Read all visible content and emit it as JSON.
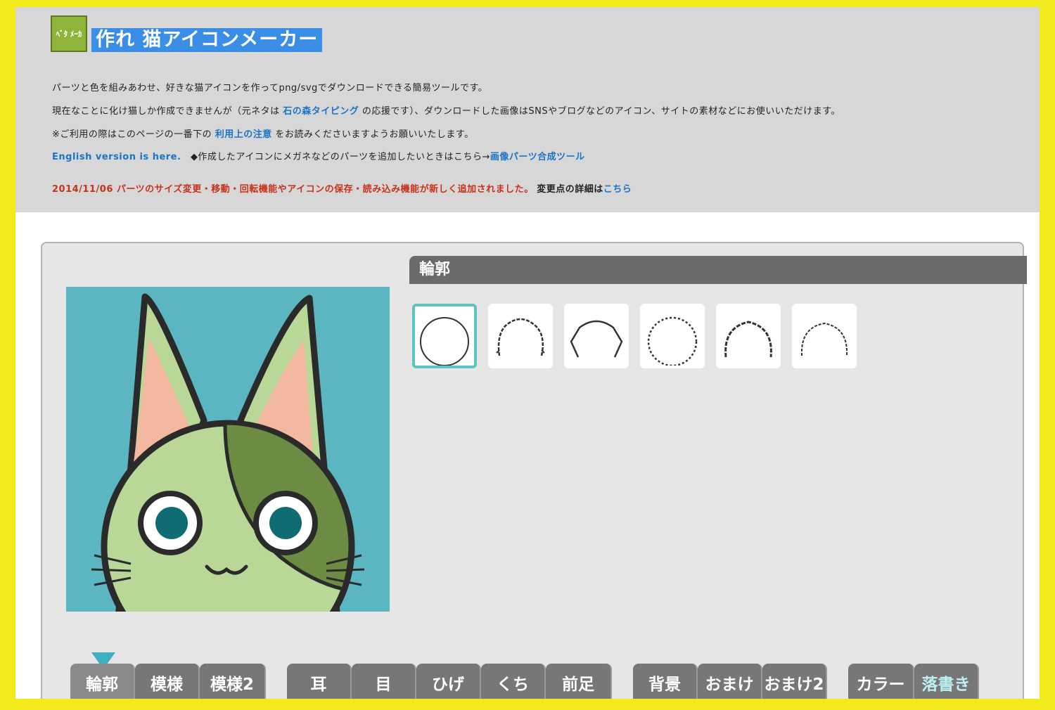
{
  "header": {
    "logo_text": "ﾍﾞﾀ\nﾒｰｶ",
    "title": "作れ 猫アイコンメーカー",
    "desc1": "パーツと色を組みあわせ、好きな猫アイコンを作ってpng/svgでダウンロードできる簡易ツールです。",
    "desc2_a": "現在なことに化け猫しか作成できませんが（元ネタは ",
    "desc2_link": "石の森タイピング",
    "desc2_b": " の応援です）、ダウンロードした画像はSNSやブログなどのアイコン、サイトの素材などにお使いいただけます。",
    "desc3_a": "※ご利用の際はこのページの一番下の ",
    "desc3_link": "利用上の注意",
    "desc3_b": " をお読みくださいますようお願いいたします。",
    "english_link": "English version is here.",
    "desc4_a": "　◆作成したアイコンにメガネなどのパーツを追加したいときはこちら→",
    "desc4_link": "画像パーツ合成ツール",
    "news": "2014/11/06 パーツのサイズ変更・移動・回転機能やアイコンの保存・読み込み機能が新しく追加されました。",
    "news_tail": "変更点の詳細は",
    "news_link": "こちら"
  },
  "editor": {
    "section_title": "輪郭",
    "options": [
      "outline-1",
      "outline-2",
      "outline-3",
      "outline-4",
      "outline-5",
      "outline-6"
    ],
    "selected_option": 0
  },
  "tabs": [
    {
      "label": "輪郭",
      "active": true
    },
    {
      "label": "模様"
    },
    {
      "label": "模様2"
    },
    {
      "label": "耳"
    },
    {
      "label": "目"
    },
    {
      "label": "ひげ"
    },
    {
      "label": "くち"
    },
    {
      "label": "前足"
    },
    {
      "label": "背景"
    },
    {
      "label": "おまけ"
    },
    {
      "label": "おまけ2"
    },
    {
      "label": "カラー"
    },
    {
      "label": "落書き"
    }
  ],
  "colors": {
    "background_frame": "#f2ea1a",
    "title_highlight": "#3a8ee6",
    "preview_bg": "#5bb6c2",
    "cat_body": "#b9d898",
    "cat_patch": "#6b8c42",
    "ear_inner": "#f2b8a0",
    "eye_iris": "#0e6c72",
    "selection": "#5cc4c0"
  }
}
